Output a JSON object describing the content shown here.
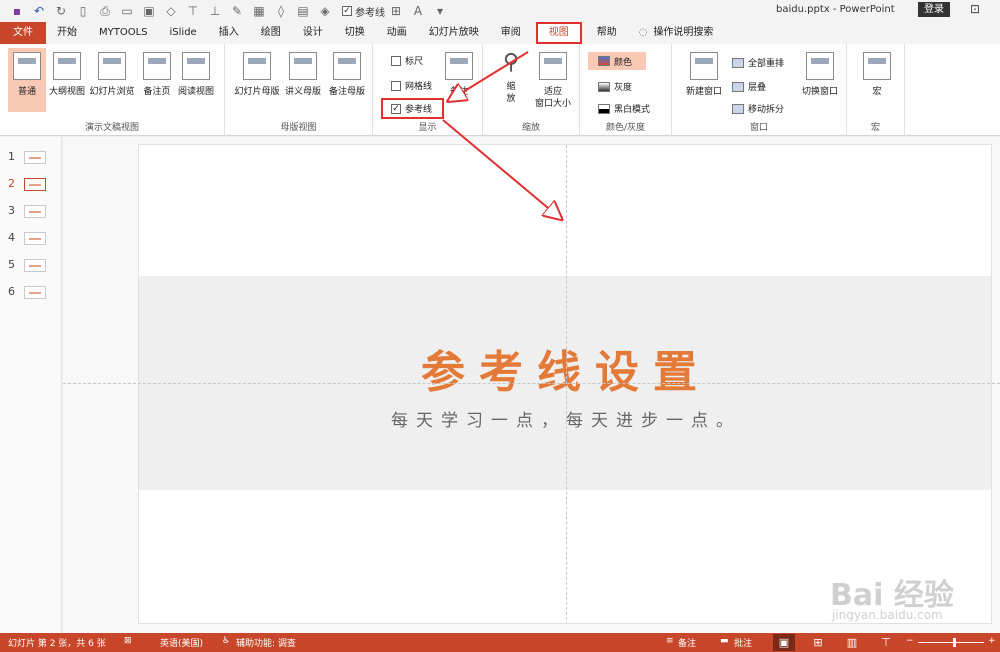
{
  "titlebar": {
    "guides_label": "参考线",
    "doc_title": "baidu.pptx  -  PowerPoint",
    "signin": "登录"
  },
  "tabs": [
    "文件",
    "开始",
    "MYTOOLS",
    "iSlide",
    "插入",
    "绘图",
    "设计",
    "切换",
    "动画",
    "幻灯片放映",
    "审阅",
    "视图",
    "帮助"
  ],
  "tell_me": "操作说明搜索",
  "ribbon": {
    "presentation_views": {
      "label": "演示文稿视图",
      "buttons": [
        "普通",
        "大纲视图",
        "幻灯片浏览",
        "备注页",
        "阅读视图"
      ]
    },
    "master_views": {
      "label": "母版视图",
      "buttons": [
        "幻灯片母版",
        "讲义母版",
        "备注母版"
      ]
    },
    "show": {
      "label": "显示",
      "ruler": "标尺",
      "gridlines": "网格线",
      "guides": "参考线",
      "notes": "备注"
    },
    "zoom": {
      "label": "缩放",
      "zoom_btn": "缩\n放",
      "fit_btn": "适应\n窗口大小"
    },
    "color": {
      "label": "颜色/灰度",
      "color": "颜色",
      "gray": "灰度",
      "bw": "黑白模式"
    },
    "window": {
      "label": "窗口",
      "new_window": "新建窗口",
      "arrange_all": "全部重排",
      "cascade": "层叠",
      "move_split": "移动拆分",
      "switch_window": "切换窗口"
    },
    "macros": {
      "label": "宏",
      "btn": "宏"
    }
  },
  "thumbnails": [
    "1",
    "2",
    "3",
    "4",
    "5",
    "6"
  ],
  "slide": {
    "title": "参考线设置",
    "subtitle": "每天学习一点，每天进步一点。"
  },
  "watermark": {
    "brand": "Bai 经验",
    "url": "jingyan.baidu.com"
  },
  "statusbar": {
    "slide_info": "幻灯片 第 2 张，共 6 张",
    "language": "英语(美国)",
    "accessibility": "辅助功能: 调查",
    "notes": "备注",
    "comments": "批注"
  },
  "colors": {
    "accent": "#c8472a",
    "title_orange": "#e47a37",
    "highlight_red": "#e03030"
  }
}
